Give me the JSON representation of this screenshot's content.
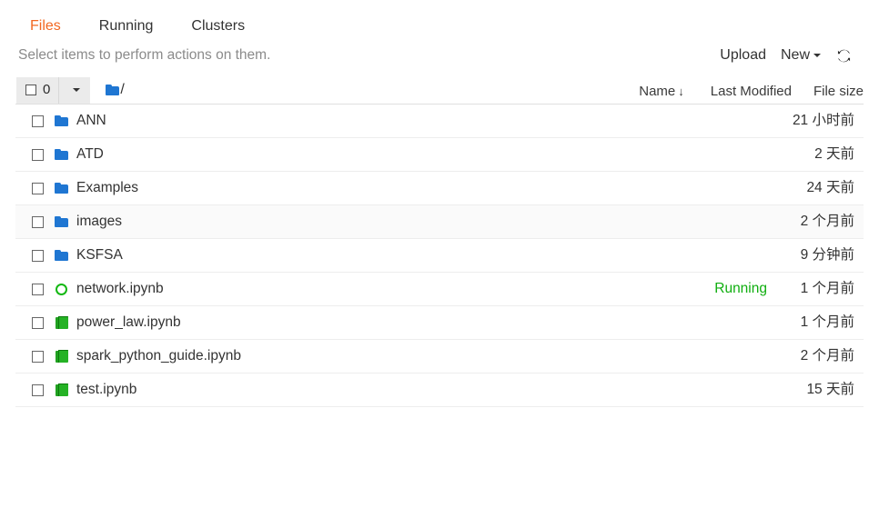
{
  "tabs": [
    {
      "label": "Files",
      "active": true
    },
    {
      "label": "Running",
      "active": false
    },
    {
      "label": "Clusters",
      "active": false
    }
  ],
  "toolbar": {
    "hint": "Select items to perform actions on them.",
    "upload_label": "Upload",
    "new_label": "New",
    "refresh_icon": "refresh-icon"
  },
  "selection": {
    "count": "0",
    "checkbox_icon": "checkbox-unchecked-icon",
    "dropdown_icon": "chevron-down-icon"
  },
  "breadcrumb": {
    "folder_icon": "folder-icon",
    "path": "/"
  },
  "columns": {
    "name": "Name",
    "sort_arrow": "↓",
    "last_modified": "Last Modified",
    "file_size": "File size"
  },
  "accent": {
    "active_tab": "#f26822",
    "folder_blue": "#1f76d2",
    "notebook_green": "#25b225",
    "running_green": "#0fae0f"
  },
  "rows": [
    {
      "icon": "folder-icon",
      "type": "folder",
      "name": "ANN",
      "status": "",
      "modified": "21 小时前",
      "size": "",
      "alt": false
    },
    {
      "icon": "folder-icon",
      "type": "folder",
      "name": "ATD",
      "status": "",
      "modified": "2 天前",
      "size": "",
      "alt": false
    },
    {
      "icon": "folder-icon",
      "type": "folder",
      "name": "Examples",
      "status": "",
      "modified": "24 天前",
      "size": "",
      "alt": false
    },
    {
      "icon": "folder-icon",
      "type": "folder",
      "name": "images",
      "status": "",
      "modified": "2 个月前",
      "size": "",
      "alt": true
    },
    {
      "icon": "folder-icon",
      "type": "folder",
      "name": "KSFSA",
      "status": "",
      "modified": "9 分钟前",
      "size": "",
      "alt": false
    },
    {
      "icon": "running-icon",
      "type": "notebook",
      "name": "network.ipynb",
      "status": "Running",
      "modified": "1 个月前",
      "size": "",
      "alt": false
    },
    {
      "icon": "notebook-icon",
      "type": "notebook",
      "name": "power_law.ipynb",
      "status": "",
      "modified": "1 个月前",
      "size": "",
      "alt": false
    },
    {
      "icon": "notebook-icon",
      "type": "notebook",
      "name": "spark_python_guide.ipynb",
      "status": "",
      "modified": "2 个月前",
      "size": "",
      "alt": false
    },
    {
      "icon": "notebook-icon",
      "type": "notebook",
      "name": "test.ipynb",
      "status": "",
      "modified": "15 天前",
      "size": "",
      "alt": false
    }
  ]
}
